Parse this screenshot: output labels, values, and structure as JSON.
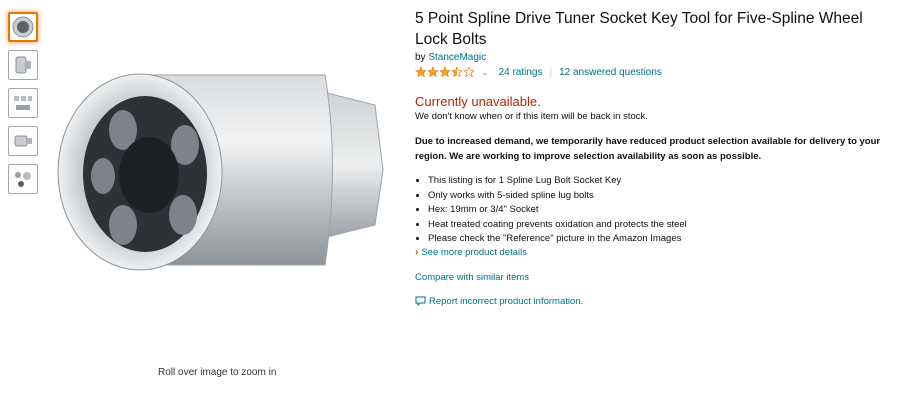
{
  "product": {
    "title": "5 Point Spline Drive Tuner Socket Key Tool for Five-Spline Wheel Lock Bolts",
    "by_prefix": "by ",
    "brand": "StanceMagic",
    "rating_value": 3.5,
    "ratings_count": "24 ratings",
    "answered_questions": "12 answered questions"
  },
  "availability": {
    "status": "Currently unavailable.",
    "note": "We don't know when or if this item will be back in stock."
  },
  "notice": "Due to increased demand, we temporarily have reduced product selection available for delivery to your region. We are working to improve selection availability as soon as possible.",
  "bullets": [
    "This listing is for 1 Spline Lug Bolt Socket Key",
    "Only works with 5-sided spline lug bolts",
    "Hex: 19mm or 3/4\" Socket",
    "Heat treated coating prevents oxidation and protects the steel",
    "Please check the \"Reference\" picture in the Amazon Images"
  ],
  "links": {
    "see_more": "See more product details",
    "compare": "Compare with similar items",
    "report": "Report incorrect product information."
  },
  "gallery": {
    "zoom_hint": "Roll over image to zoom in",
    "thumbnails": [
      "socket-front",
      "socket-side",
      "socket-set",
      "socket-angle",
      "socket-reference"
    ]
  },
  "colors": {
    "link": "#007185",
    "unavailable": "#b12704",
    "star": "#ffa41c",
    "selected_thumb": "#e77600"
  }
}
